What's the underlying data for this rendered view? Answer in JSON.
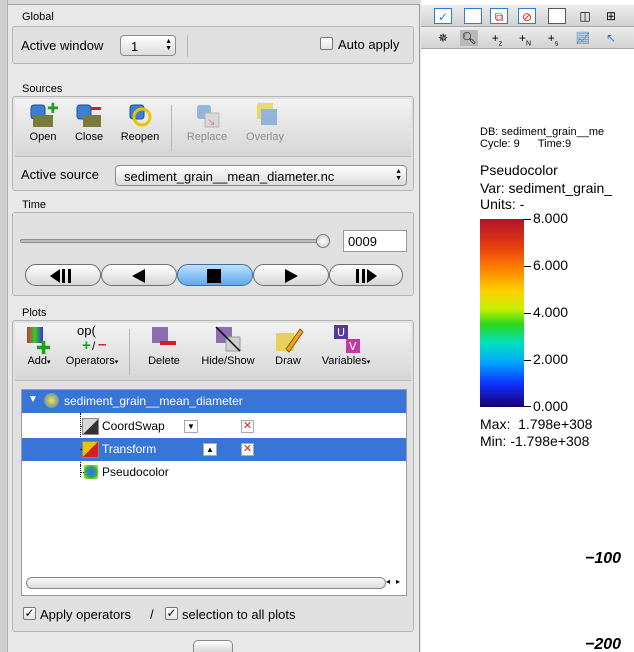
{
  "global": {
    "section": "Global",
    "active_window_label": "Active window",
    "active_window_value": "1",
    "auto_apply_label": "Auto apply"
  },
  "sources": {
    "section": "Sources",
    "tools": [
      "Open",
      "Close",
      "Reopen",
      "Replace",
      "Overlay"
    ],
    "active_source_label": "Active source",
    "active_source_value": "sediment_grain__mean_diameter.nc"
  },
  "time": {
    "section": "Time",
    "frame_value": "0009",
    "slider_fraction": 1.0
  },
  "plots": {
    "section": "Plots",
    "tools": [
      "Add",
      "Operators",
      "Delete",
      "Hide/Show",
      "Draw",
      "Variables"
    ],
    "operators_glyph": "op(",
    "tree": {
      "root": "sediment_grain__mean_diameter",
      "children": [
        "CoordSwap",
        "Transform",
        "Pseudocolor"
      ]
    },
    "apply_operators_label": "Apply operators",
    "slash": "/",
    "selection_label": "selection to all plots"
  },
  "viz": {
    "db_line": "DB: sediment_grain__me",
    "cycle_line": "Cycle: 9      Time:9",
    "legend_title": "Pseudocolor",
    "var_line": "Var: sediment_grain_",
    "units_line": "Units: -",
    "ticks": [
      "8.000",
      "6.000",
      "4.000",
      "2.000",
      "0.000"
    ],
    "max_line": "Max:  1.798e+308",
    "min_line": "Min: -1.798e+308",
    "axis_labels": [
      "−100",
      "−200"
    ]
  },
  "colors": {
    "selection_blue": "#3875d7",
    "vcr_active": "#5fa8ec"
  }
}
